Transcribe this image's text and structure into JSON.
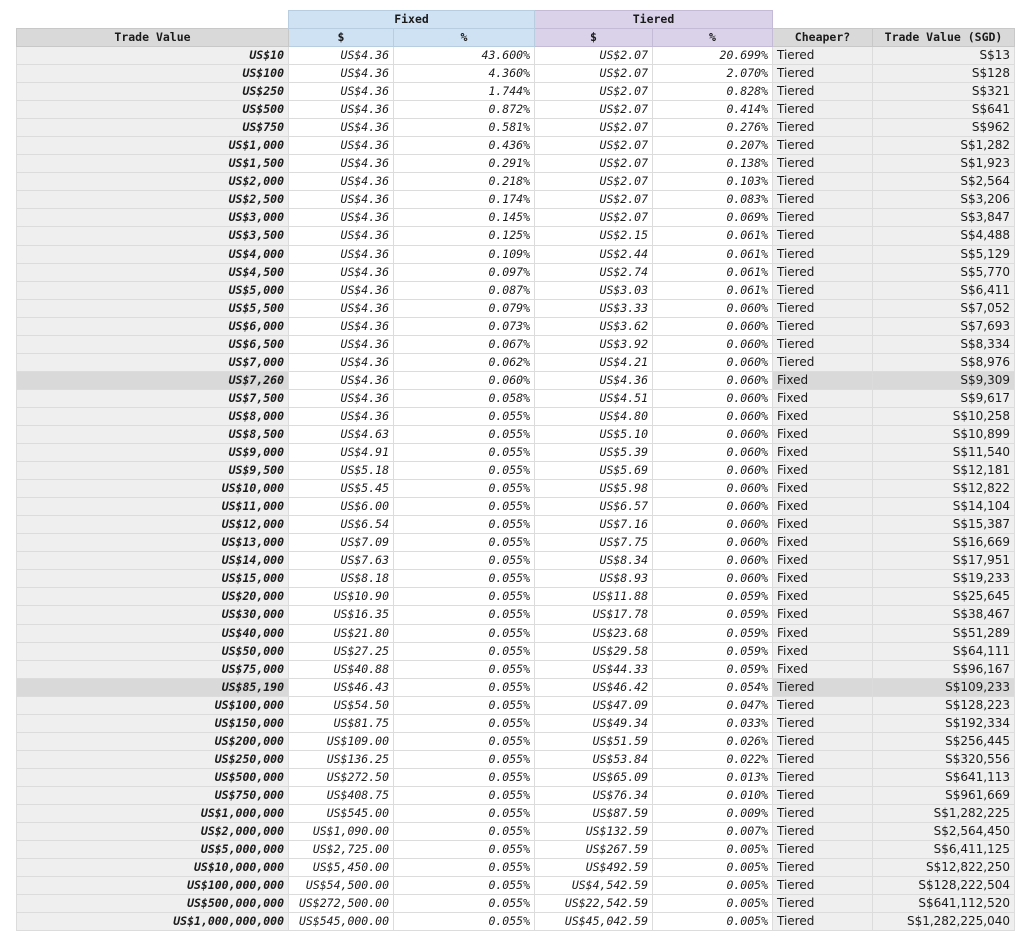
{
  "table": {
    "groups": {
      "fixed": "Fixed",
      "tiered": "Tiered"
    },
    "headers": {
      "trade_value": "Trade Value",
      "fixed_dollar": "$",
      "fixed_pct": "%",
      "tiered_dollar": "$",
      "tiered_pct": "%",
      "cheaper": "Cheaper?",
      "trade_value_sgd": "Trade Value (SGD)"
    },
    "rows": [
      {
        "tv": "US$10",
        "fd": "US$4.36",
        "fp": "43.600%",
        "td": "US$2.07",
        "tp": "20.699%",
        "ch": "Tiered",
        "sgd": "S$13",
        "hl": false
      },
      {
        "tv": "US$100",
        "fd": "US$4.36",
        "fp": "4.360%",
        "td": "US$2.07",
        "tp": "2.070%",
        "ch": "Tiered",
        "sgd": "S$128",
        "hl": false
      },
      {
        "tv": "US$250",
        "fd": "US$4.36",
        "fp": "1.744%",
        "td": "US$2.07",
        "tp": "0.828%",
        "ch": "Tiered",
        "sgd": "S$321",
        "hl": false
      },
      {
        "tv": "US$500",
        "fd": "US$4.36",
        "fp": "0.872%",
        "td": "US$2.07",
        "tp": "0.414%",
        "ch": "Tiered",
        "sgd": "S$641",
        "hl": false
      },
      {
        "tv": "US$750",
        "fd": "US$4.36",
        "fp": "0.581%",
        "td": "US$2.07",
        "tp": "0.276%",
        "ch": "Tiered",
        "sgd": "S$962",
        "hl": false
      },
      {
        "tv": "US$1,000",
        "fd": "US$4.36",
        "fp": "0.436%",
        "td": "US$2.07",
        "tp": "0.207%",
        "ch": "Tiered",
        "sgd": "S$1,282",
        "hl": false
      },
      {
        "tv": "US$1,500",
        "fd": "US$4.36",
        "fp": "0.291%",
        "td": "US$2.07",
        "tp": "0.138%",
        "ch": "Tiered",
        "sgd": "S$1,923",
        "hl": false
      },
      {
        "tv": "US$2,000",
        "fd": "US$4.36",
        "fp": "0.218%",
        "td": "US$2.07",
        "tp": "0.103%",
        "ch": "Tiered",
        "sgd": "S$2,564",
        "hl": false
      },
      {
        "tv": "US$2,500",
        "fd": "US$4.36",
        "fp": "0.174%",
        "td": "US$2.07",
        "tp": "0.083%",
        "ch": "Tiered",
        "sgd": "S$3,206",
        "hl": false
      },
      {
        "tv": "US$3,000",
        "fd": "US$4.36",
        "fp": "0.145%",
        "td": "US$2.07",
        "tp": "0.069%",
        "ch": "Tiered",
        "sgd": "S$3,847",
        "hl": false
      },
      {
        "tv": "US$3,500",
        "fd": "US$4.36",
        "fp": "0.125%",
        "td": "US$2.15",
        "tp": "0.061%",
        "ch": "Tiered",
        "sgd": "S$4,488",
        "hl": false
      },
      {
        "tv": "US$4,000",
        "fd": "US$4.36",
        "fp": "0.109%",
        "td": "US$2.44",
        "tp": "0.061%",
        "ch": "Tiered",
        "sgd": "S$5,129",
        "hl": false
      },
      {
        "tv": "US$4,500",
        "fd": "US$4.36",
        "fp": "0.097%",
        "td": "US$2.74",
        "tp": "0.061%",
        "ch": "Tiered",
        "sgd": "S$5,770",
        "hl": false
      },
      {
        "tv": "US$5,000",
        "fd": "US$4.36",
        "fp": "0.087%",
        "td": "US$3.03",
        "tp": "0.061%",
        "ch": "Tiered",
        "sgd": "S$6,411",
        "hl": false
      },
      {
        "tv": "US$5,500",
        "fd": "US$4.36",
        "fp": "0.079%",
        "td": "US$3.33",
        "tp": "0.060%",
        "ch": "Tiered",
        "sgd": "S$7,052",
        "hl": false
      },
      {
        "tv": "US$6,000",
        "fd": "US$4.36",
        "fp": "0.073%",
        "td": "US$3.62",
        "tp": "0.060%",
        "ch": "Tiered",
        "sgd": "S$7,693",
        "hl": false
      },
      {
        "tv": "US$6,500",
        "fd": "US$4.36",
        "fp": "0.067%",
        "td": "US$3.92",
        "tp": "0.060%",
        "ch": "Tiered",
        "sgd": "S$8,334",
        "hl": false
      },
      {
        "tv": "US$7,000",
        "fd": "US$4.36",
        "fp": "0.062%",
        "td": "US$4.21",
        "tp": "0.060%",
        "ch": "Tiered",
        "sgd": "S$8,976",
        "hl": false
      },
      {
        "tv": "US$7,260",
        "fd": "US$4.36",
        "fp": "0.060%",
        "td": "US$4.36",
        "tp": "0.060%",
        "ch": "Fixed",
        "sgd": "S$9,309",
        "hl": true
      },
      {
        "tv": "US$7,500",
        "fd": "US$4.36",
        "fp": "0.058%",
        "td": "US$4.51",
        "tp": "0.060%",
        "ch": "Fixed",
        "sgd": "S$9,617",
        "hl": false
      },
      {
        "tv": "US$8,000",
        "fd": "US$4.36",
        "fp": "0.055%",
        "td": "US$4.80",
        "tp": "0.060%",
        "ch": "Fixed",
        "sgd": "S$10,258",
        "hl": false
      },
      {
        "tv": "US$8,500",
        "fd": "US$4.63",
        "fp": "0.055%",
        "td": "US$5.10",
        "tp": "0.060%",
        "ch": "Fixed",
        "sgd": "S$10,899",
        "hl": false
      },
      {
        "tv": "US$9,000",
        "fd": "US$4.91",
        "fp": "0.055%",
        "td": "US$5.39",
        "tp": "0.060%",
        "ch": "Fixed",
        "sgd": "S$11,540",
        "hl": false
      },
      {
        "tv": "US$9,500",
        "fd": "US$5.18",
        "fp": "0.055%",
        "td": "US$5.69",
        "tp": "0.060%",
        "ch": "Fixed",
        "sgd": "S$12,181",
        "hl": false
      },
      {
        "tv": "US$10,000",
        "fd": "US$5.45",
        "fp": "0.055%",
        "td": "US$5.98",
        "tp": "0.060%",
        "ch": "Fixed",
        "sgd": "S$12,822",
        "hl": false
      },
      {
        "tv": "US$11,000",
        "fd": "US$6.00",
        "fp": "0.055%",
        "td": "US$6.57",
        "tp": "0.060%",
        "ch": "Fixed",
        "sgd": "S$14,104",
        "hl": false
      },
      {
        "tv": "US$12,000",
        "fd": "US$6.54",
        "fp": "0.055%",
        "td": "US$7.16",
        "tp": "0.060%",
        "ch": "Fixed",
        "sgd": "S$15,387",
        "hl": false
      },
      {
        "tv": "US$13,000",
        "fd": "US$7.09",
        "fp": "0.055%",
        "td": "US$7.75",
        "tp": "0.060%",
        "ch": "Fixed",
        "sgd": "S$16,669",
        "hl": false
      },
      {
        "tv": "US$14,000",
        "fd": "US$7.63",
        "fp": "0.055%",
        "td": "US$8.34",
        "tp": "0.060%",
        "ch": "Fixed",
        "sgd": "S$17,951",
        "hl": false
      },
      {
        "tv": "US$15,000",
        "fd": "US$8.18",
        "fp": "0.055%",
        "td": "US$8.93",
        "tp": "0.060%",
        "ch": "Fixed",
        "sgd": "S$19,233",
        "hl": false
      },
      {
        "tv": "US$20,000",
        "fd": "US$10.90",
        "fp": "0.055%",
        "td": "US$11.88",
        "tp": "0.059%",
        "ch": "Fixed",
        "sgd": "S$25,645",
        "hl": false
      },
      {
        "tv": "US$30,000",
        "fd": "US$16.35",
        "fp": "0.055%",
        "td": "US$17.78",
        "tp": "0.059%",
        "ch": "Fixed",
        "sgd": "S$38,467",
        "hl": false
      },
      {
        "tv": "US$40,000",
        "fd": "US$21.80",
        "fp": "0.055%",
        "td": "US$23.68",
        "tp": "0.059%",
        "ch": "Fixed",
        "sgd": "S$51,289",
        "hl": false
      },
      {
        "tv": "US$50,000",
        "fd": "US$27.25",
        "fp": "0.055%",
        "td": "US$29.58",
        "tp": "0.059%",
        "ch": "Fixed",
        "sgd": "S$64,111",
        "hl": false
      },
      {
        "tv": "US$75,000",
        "fd": "US$40.88",
        "fp": "0.055%",
        "td": "US$44.33",
        "tp": "0.059%",
        "ch": "Fixed",
        "sgd": "S$96,167",
        "hl": false
      },
      {
        "tv": "US$85,190",
        "fd": "US$46.43",
        "fp": "0.055%",
        "td": "US$46.42",
        "tp": "0.054%",
        "ch": "Tiered",
        "sgd": "S$109,233",
        "hl": true
      },
      {
        "tv": "US$100,000",
        "fd": "US$54.50",
        "fp": "0.055%",
        "td": "US$47.09",
        "tp": "0.047%",
        "ch": "Tiered",
        "sgd": "S$128,223",
        "hl": false
      },
      {
        "tv": "US$150,000",
        "fd": "US$81.75",
        "fp": "0.055%",
        "td": "US$49.34",
        "tp": "0.033%",
        "ch": "Tiered",
        "sgd": "S$192,334",
        "hl": false
      },
      {
        "tv": "US$200,000",
        "fd": "US$109.00",
        "fp": "0.055%",
        "td": "US$51.59",
        "tp": "0.026%",
        "ch": "Tiered",
        "sgd": "S$256,445",
        "hl": false
      },
      {
        "tv": "US$250,000",
        "fd": "US$136.25",
        "fp": "0.055%",
        "td": "US$53.84",
        "tp": "0.022%",
        "ch": "Tiered",
        "sgd": "S$320,556",
        "hl": false
      },
      {
        "tv": "US$500,000",
        "fd": "US$272.50",
        "fp": "0.055%",
        "td": "US$65.09",
        "tp": "0.013%",
        "ch": "Tiered",
        "sgd": "S$641,113",
        "hl": false
      },
      {
        "tv": "US$750,000",
        "fd": "US$408.75",
        "fp": "0.055%",
        "td": "US$76.34",
        "tp": "0.010%",
        "ch": "Tiered",
        "sgd": "S$961,669",
        "hl": false
      },
      {
        "tv": "US$1,000,000",
        "fd": "US$545.00",
        "fp": "0.055%",
        "td": "US$87.59",
        "tp": "0.009%",
        "ch": "Tiered",
        "sgd": "S$1,282,225",
        "hl": false
      },
      {
        "tv": "US$2,000,000",
        "fd": "US$1,090.00",
        "fp": "0.055%",
        "td": "US$132.59",
        "tp": "0.007%",
        "ch": "Tiered",
        "sgd": "S$2,564,450",
        "hl": false
      },
      {
        "tv": "US$5,000,000",
        "fd": "US$2,725.00",
        "fp": "0.055%",
        "td": "US$267.59",
        "tp": "0.005%",
        "ch": "Tiered",
        "sgd": "S$6,411,125",
        "hl": false
      },
      {
        "tv": "US$10,000,000",
        "fd": "US$5,450.00",
        "fp": "0.055%",
        "td": "US$492.59",
        "tp": "0.005%",
        "ch": "Tiered",
        "sgd": "S$12,822,250",
        "hl": false
      },
      {
        "tv": "US$100,000,000",
        "fd": "US$54,500.00",
        "fp": "0.055%",
        "td": "US$4,542.59",
        "tp": "0.005%",
        "ch": "Tiered",
        "sgd": "S$128,222,504",
        "hl": false
      },
      {
        "tv": "US$500,000,000",
        "fd": "US$272,500.00",
        "fp": "0.055%",
        "td": "US$22,542.59",
        "tp": "0.005%",
        "ch": "Tiered",
        "sgd": "S$641,112,520",
        "hl": false
      },
      {
        "tv": "US$1,000,000,000",
        "fd": "US$545,000.00",
        "fp": "0.055%",
        "td": "US$45,042.59",
        "tp": "0.005%",
        "ch": "Tiered",
        "sgd": "S$1,282,225,040",
        "hl": false
      }
    ]
  }
}
